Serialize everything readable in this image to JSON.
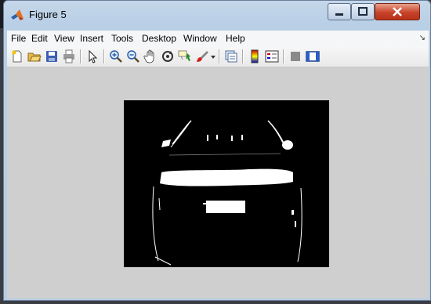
{
  "window": {
    "title": "Figure 5"
  },
  "menu": [
    "File",
    "Edit",
    "View",
    "Insert",
    "Tools",
    "Desktop",
    "Window",
    "Help"
  ],
  "toolbar_icons": [
    "new-figure-icon",
    "open-file-icon",
    "save-icon",
    "print-icon",
    "edit-plot-arrow-icon",
    "zoom-in-icon",
    "zoom-out-icon",
    "pan-hand-icon",
    "rotate-3d-icon",
    "data-cursor-icon",
    "brush-icon",
    "link-plot-icon",
    "colorbar-icon",
    "legend-icon",
    "hide-plot-tools-icon",
    "show-plot-tools-icon"
  ],
  "colors": {
    "titlebar": "#b9cfe6",
    "close": "#c7432a",
    "figure_bg": "#cfcfcf",
    "axes_bg": "#000000"
  }
}
